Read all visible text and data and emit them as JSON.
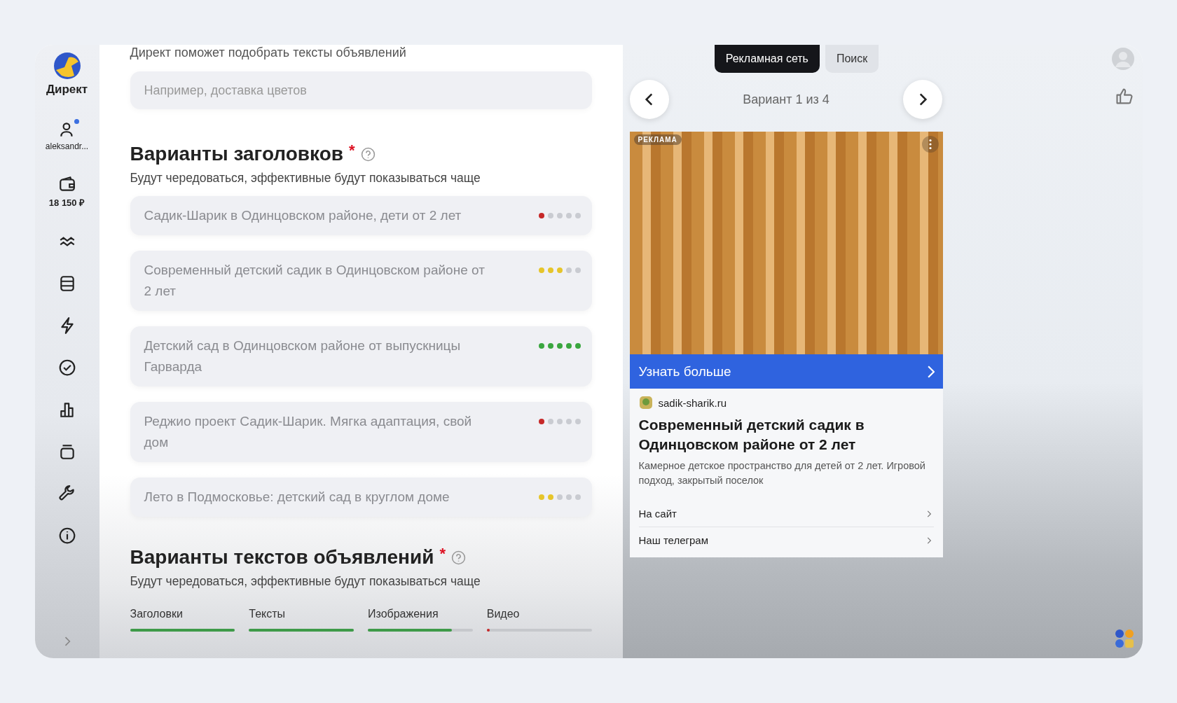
{
  "sidebar": {
    "logo_text": "Директ",
    "user": {
      "name": "aleksandr...",
      "notification": true
    },
    "balance": "18 150 ₽"
  },
  "form": {
    "hint": "Директ поможет подобрать тексты объявлений",
    "search": {
      "placeholder": "Например, доставка цветов"
    },
    "headlines_section": {
      "title": "Варианты заголовков",
      "required_mark": "*",
      "subtitle": "Будут чередоваться, эффективные будут показываться чаще"
    },
    "headlines": [
      {
        "text": "Садик-Шарик в Одинцовском районе, дети от 2 лет",
        "stars": 1
      },
      {
        "text": "Современный детский садик в Одинцовском районе от 2 лет",
        "stars": 3
      },
      {
        "text": "Детский сад в Одинцовском районе от выпускницы Гарварда",
        "stars": 5
      },
      {
        "text": "Реджио проект Садик-Шарик. Мягка адаптация, свой дом",
        "stars": 1
      },
      {
        "text": "Лето в Подмосковье: детский сад в круглом доме",
        "stars": 2
      }
    ],
    "texts_section": {
      "title": "Варианты текстов объявлений",
      "required_mark": "*",
      "subtitle": "Будут чередоваться, эффективные будут показываться чаще"
    },
    "progress": [
      {
        "label": "Заголовки",
        "level": 1
      },
      {
        "label": "Тексты",
        "level": 1
      },
      {
        "label": "Изображения",
        "level": 0.8
      },
      {
        "label": "Видео",
        "level": 0.03
      }
    ]
  },
  "preview": {
    "tabs": [
      {
        "label": "Рекламная сеть",
        "selected": true
      },
      {
        "label": "Поиск",
        "selected": false
      }
    ],
    "variant": "Вариант 1 из 4",
    "ad": {
      "badge": "РЕКЛАМА",
      "button": "Узнать больше",
      "domain": "sadik-sharik.ru",
      "title": "Современный детский садик в Одинцовском районе от 2 лет",
      "description": "Камерное детское пространство для детей от 2 лет. Игровой подход, закрытый поселок",
      "links": [
        "На сайт",
        "Наш телеграм"
      ]
    }
  }
}
